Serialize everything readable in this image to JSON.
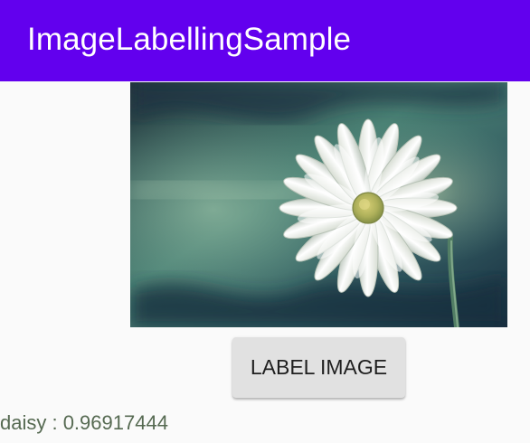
{
  "app_bar": {
    "title": "ImageLabellingSample",
    "color": "#6200ee"
  },
  "image": {
    "subject_icon": "daisy-photo"
  },
  "button": {
    "label": "LABEL IMAGE"
  },
  "result": {
    "text": "daisy : 0.96917444"
  }
}
